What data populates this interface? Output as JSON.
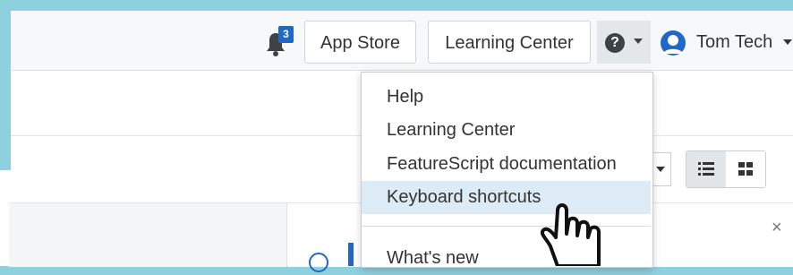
{
  "navbar": {
    "notification_count": "3",
    "app_store_label": "App Store",
    "learning_center_label": "Learning Center",
    "user_name": "Tom Tech"
  },
  "help_menu": {
    "items": [
      {
        "label": "Help"
      },
      {
        "label": "Learning Center"
      },
      {
        "label": "FeatureScript documentation"
      },
      {
        "label": "Keyboard shortcuts"
      },
      {
        "label": "What's new"
      }
    ],
    "highlighted_item": "Keyboard shortcuts"
  },
  "panel": {
    "close_glyph": "×"
  },
  "colors": {
    "frame": "#8fd0de",
    "accent": "#1f67c8",
    "highlight": "#dcebf6"
  },
  "icons": [
    "bell-icon",
    "help-icon",
    "user-avatar-icon",
    "list-view-icon",
    "grid-view-icon",
    "info-icon",
    "pointer-hand-icon"
  ]
}
